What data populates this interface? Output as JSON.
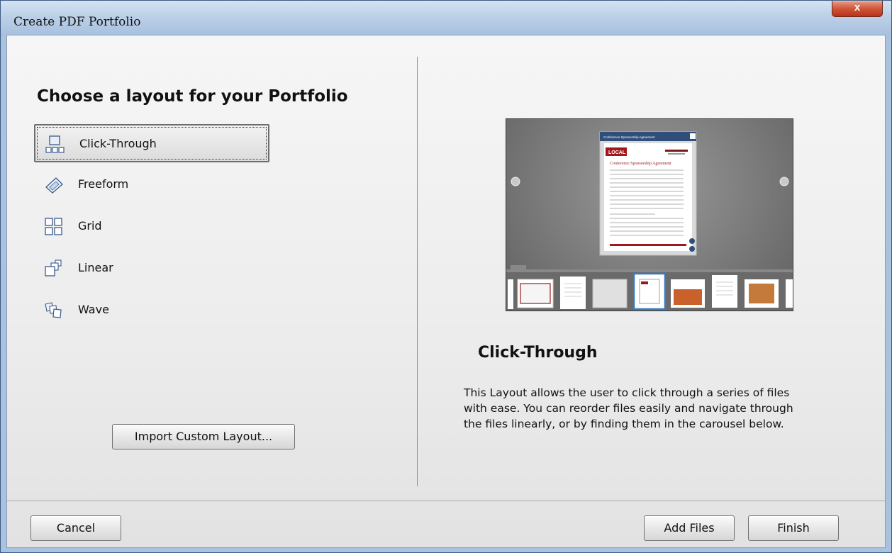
{
  "window": {
    "title": "Create PDF Portfolio",
    "close_label": "x"
  },
  "left": {
    "heading": "Choose a layout for your Portfolio",
    "layouts": [
      {
        "label": "Click-Through",
        "icon": "click-through-icon",
        "selected": true
      },
      {
        "label": "Freeform",
        "icon": "freeform-icon",
        "selected": false
      },
      {
        "label": "Grid",
        "icon": "grid-icon",
        "selected": false
      },
      {
        "label": "Linear",
        "icon": "linear-icon",
        "selected": false
      },
      {
        "label": "Wave",
        "icon": "wave-icon",
        "selected": false
      }
    ],
    "import_button": "Import Custom Layout..."
  },
  "right": {
    "preview_name": "Click-Through",
    "preview_doc_header": "Conference Sponsorship Agreement",
    "preview_doc_badge": "LOCAL",
    "preview_doc_title": "Conference Sponsorship Agreement",
    "description_lines": [
      "This Layout allows the user to click through a series of files",
      "with ease. You can reorder files easily and navigate through",
      "the files linearly, or by finding them in the carousel below."
    ]
  },
  "footer": {
    "cancel": "Cancel",
    "add_files": "Add Files",
    "finish": "Finish"
  },
  "colors": {
    "titlebar": "#bcd0e8",
    "close_button": "#c8442a",
    "selection_border": "#6d6d6d",
    "preview_bg": "#7a7a7a",
    "doc_accent": "#a0181c"
  }
}
